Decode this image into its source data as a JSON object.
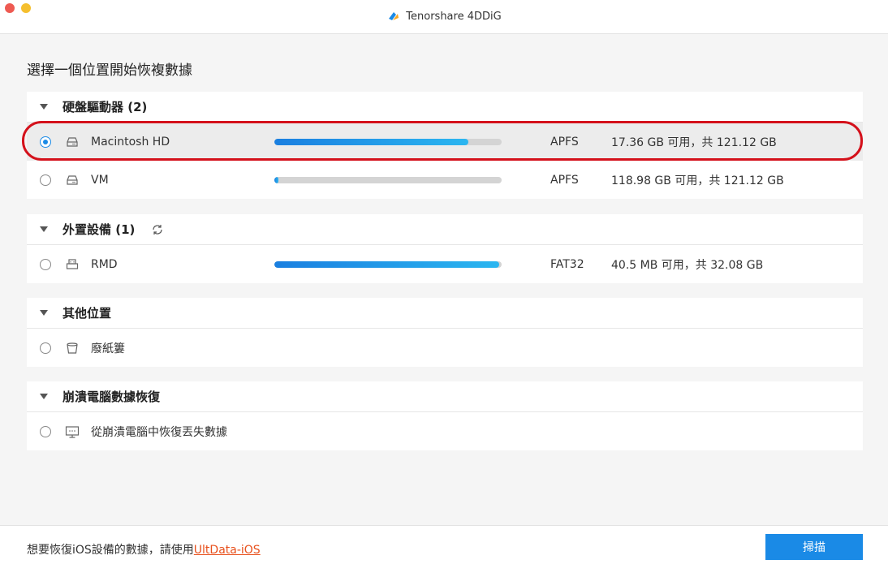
{
  "window": {
    "title": "Tenorshare 4DDiG"
  },
  "page": {
    "heading": "選擇一個位置開始恢複數據"
  },
  "sections": [
    {
      "title": "硬盤驅動器 (2)",
      "items": [
        {
          "name": "Macintosh HD",
          "filesystem": "APFS",
          "capacity": "17.36 GB 可用，共 121.12 GB",
          "used_fraction": 0.853,
          "selected": true,
          "icon": "hard-drive-icon"
        },
        {
          "name": "VM",
          "filesystem": "APFS",
          "capacity": "118.98 GB 可用，共 121.12 GB",
          "used_fraction": 0.018,
          "selected": false,
          "icon": "hard-drive-icon"
        }
      ]
    },
    {
      "title": "外置設備 (1)",
      "items": [
        {
          "name": "RMD",
          "filesystem": "FAT32",
          "capacity": "40.5 MB 可用，共 32.08 GB",
          "used_fraction": 0.99,
          "selected": false,
          "icon": "external-drive-icon"
        }
      ]
    },
    {
      "title": "其他位置",
      "items": [
        {
          "name": "廢紙簍",
          "selected": false,
          "icon": "trash-icon"
        }
      ]
    },
    {
      "title": "崩潰電腦數據恢復",
      "items": [
        {
          "name": "從崩潰電腦中恢復丟失數據",
          "selected": false,
          "icon": "monitor-icon"
        }
      ]
    }
  ],
  "footer": {
    "text": "想要恢復iOS設備的數據，請使用",
    "link": "UltData-iOS",
    "scan_button": "掃描"
  },
  "colors": {
    "accent": "#1a8ae6",
    "highlight": "#d4111b",
    "link": "#e8501c"
  }
}
